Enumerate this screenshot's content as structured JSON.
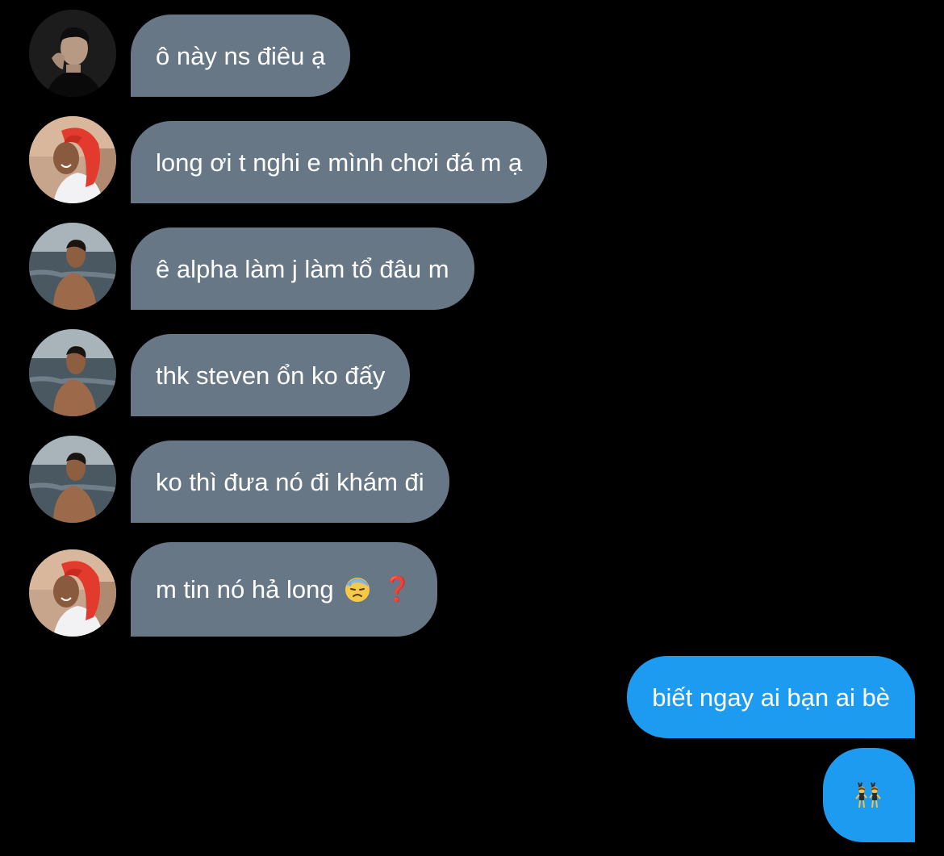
{
  "conversation": {
    "messages": [
      {
        "direction": "incoming",
        "avatar": "man-dark-shirt-avatar",
        "text": "ô này ns điêu ạ"
      },
      {
        "direction": "incoming",
        "avatar": "person-red-hood-avatar",
        "text": "long ơi t nghi e mình chơi đá m ạ"
      },
      {
        "direction": "incoming",
        "avatar": "shirtless-beach-avatar",
        "text": "ê alpha làm j làm tổ đâu m"
      },
      {
        "direction": "incoming",
        "avatar": "shirtless-beach-avatar",
        "text": "thk steven ổn ko đấy"
      },
      {
        "direction": "incoming",
        "avatar": "shirtless-beach-avatar",
        "text": "ko thì đưa nó đi khám đi"
      },
      {
        "direction": "incoming",
        "avatar": "person-red-hood-avatar",
        "text": "m tin nó hả long",
        "emojis": [
          "downcast-face-with-sweat-emoji",
          "red-question-mark-emoji"
        ],
        "emoji_q": "❓"
      },
      {
        "direction": "outgoing",
        "text": "biết ngay ai bạn ai bè"
      },
      {
        "direction": "outgoing",
        "emojis": [
          "women-with-bunny-ears-emoji"
        ]
      }
    ]
  },
  "colors": {
    "background": "#000000",
    "incoming_bubble": "#677786",
    "outgoing_bubble": "#1d9bf0",
    "text": "#ffffff"
  }
}
